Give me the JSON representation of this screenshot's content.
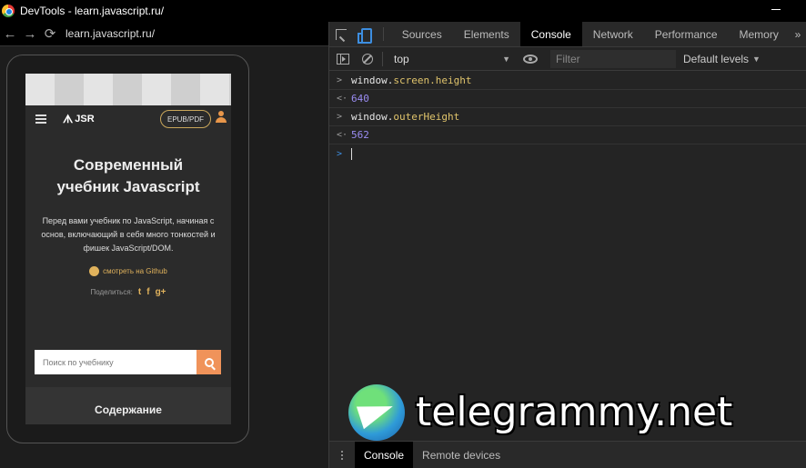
{
  "window": {
    "title": "DevTools - learn.javascript.ru/"
  },
  "addressbar": {
    "url": "learn.javascript.ru/"
  },
  "site": {
    "epub_label": "EPUB/PDF",
    "logo_text": "JSR",
    "hero_title_line1": "Современный",
    "hero_title_line2": "учебник Javascript",
    "hero_desc": "Перед вами учебник по JavaScript, начиная с основ, включающий в себя много тонкостей и фишек JavaScript/DOM.",
    "github_link": "смотреть на Github",
    "share_label": "Поделиться:",
    "social": [
      "t",
      "f",
      "g+"
    ],
    "search_placeholder": "Поиск по учебнику",
    "toc_title": "Содержание"
  },
  "devtools": {
    "tabs": [
      "Sources",
      "Elements",
      "Console",
      "Network",
      "Performance",
      "Memory"
    ],
    "active_tab": "Console",
    "more": "»",
    "context": "top",
    "filter_placeholder": "Filter",
    "levels_label": "Default levels",
    "console": [
      {
        "type": "input",
        "obj": "window",
        "prop": "screen.height"
      },
      {
        "type": "output",
        "value": "640"
      },
      {
        "type": "input",
        "obj": "window",
        "prop": "outerHeight"
      },
      {
        "type": "output",
        "value": "562"
      }
    ],
    "drawer_tabs": [
      "Console",
      "Remote devices"
    ]
  },
  "watermark": {
    "text": "telegrammy.net"
  },
  "colors": {
    "accent": "#3d8ee0",
    "active_tab_bg": "#000000",
    "search_button": "#f0935a",
    "link": "#e0b25c"
  }
}
